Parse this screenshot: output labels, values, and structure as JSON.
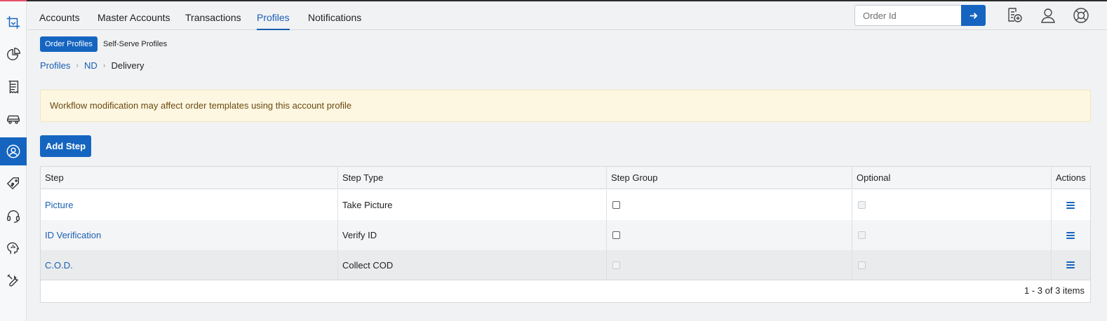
{
  "sidebar": {
    "items": [
      {
        "icon": "crop-logo-icon"
      },
      {
        "icon": "pie-chart-icon"
      },
      {
        "icon": "receipt-icon"
      },
      {
        "icon": "car-icon"
      },
      {
        "icon": "user-circle-icon",
        "active": true
      },
      {
        "icon": "price-tag-icon"
      },
      {
        "icon": "headset-icon"
      },
      {
        "icon": "head-analytics-icon"
      },
      {
        "icon": "tools-icon"
      }
    ],
    "active_color": "#1565c0"
  },
  "nav": {
    "tabs": [
      "Accounts",
      "Master Accounts",
      "Transactions",
      "Profiles",
      "Notifications"
    ],
    "active_tab": "Profiles"
  },
  "search": {
    "placeholder": "Order Id",
    "button_icon": "arrow-right-icon"
  },
  "header_icons": [
    "document-add-icon",
    "user-icon",
    "lifebuoy-icon"
  ],
  "subtabs": [
    "Order Profiles",
    "Self-Serve Profiles"
  ],
  "breadcrumb": {
    "links": [
      "Profiles",
      "ND"
    ],
    "current": "Delivery"
  },
  "alert": {
    "text": "Workflow modification may affect order templates using this account profile"
  },
  "add_step_label": "Add Step",
  "table": {
    "columns": [
      "Step",
      "Step Type",
      "Step Group",
      "Optional",
      "Actions"
    ],
    "rows": [
      {
        "step": "Picture",
        "type": "Take Picture",
        "group_enabled": true,
        "optional_enabled": false
      },
      {
        "step": "ID Verification",
        "type": "Verify ID",
        "group_enabled": true,
        "optional_enabled": false
      },
      {
        "step": "C.O.D.",
        "type": "Collect COD",
        "group_enabled": false,
        "optional_enabled": false
      }
    ],
    "pager": "1 - 3 of 3 items"
  },
  "colors": {
    "primary": "#1565c0",
    "link": "#1a5fb4",
    "alert_bg": "#fdf6e0",
    "alert_text": "#6a4a12",
    "accent": "#e8506a"
  }
}
